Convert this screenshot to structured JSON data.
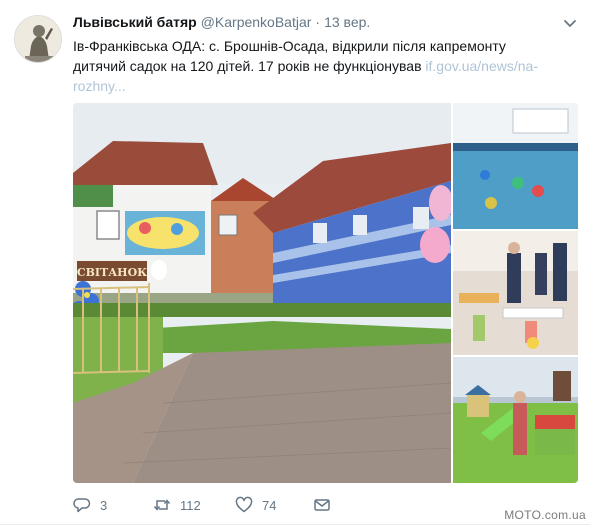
{
  "tweet": {
    "author_name": "Львівський батяр",
    "handle": "@KarpenkoBatjar",
    "separator": "·",
    "date": "13 вер.",
    "text_line1": "Ів-Франківська ОДА: с. Брошнів-Осада, відкрили після капремонту",
    "text_line2": "дитячий садок на 120 дітей. 17 років не функціонував",
    "link_part1": "if.gov.ua/news/na-",
    "link_part2": "rozhny...",
    "sign_text": "СВІТАНОК"
  },
  "actions": {
    "reply_count": "3",
    "retweet_count": "112",
    "like_count": "74",
    "reply_icon": "reply-icon",
    "retweet_icon": "retweet-icon",
    "like_icon": "heart-icon",
    "dm_icon": "direct-message-icon"
  },
  "watermark": "MOTO.com.ua",
  "colors": {
    "text_primary": "#14171a",
    "text_secondary": "#657786",
    "link": "#b0c4d6"
  }
}
